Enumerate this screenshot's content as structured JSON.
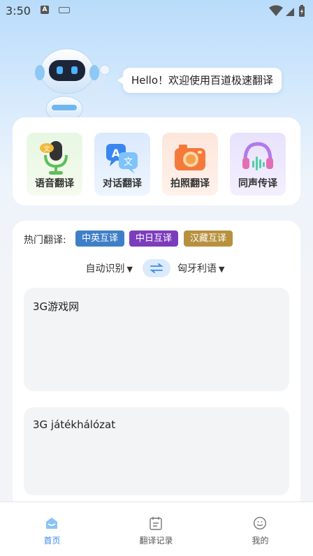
{
  "status_bar": {
    "time": "3:50",
    "notif_letter": "A"
  },
  "header": {
    "greeting": "Hello！欢迎使用百道极速翻译"
  },
  "features": [
    {
      "label": "语音翻译",
      "icon": "voice-translate-icon"
    },
    {
      "label": "对话翻译",
      "icon": "dialog-translate-icon"
    },
    {
      "label": "拍照翻译",
      "icon": "camera-translate-icon"
    },
    {
      "label": "同声传译",
      "icon": "simultaneous-interpret-icon"
    }
  ],
  "translate": {
    "hot_label": "热门翻译:",
    "hot_chips": [
      {
        "label": "中英互译",
        "color": "#3f7fc8"
      },
      {
        "label": "中日互译",
        "color": "#7c3dbd"
      },
      {
        "label": "汉藏互译",
        "color": "#b8913f"
      }
    ],
    "source_lang": "自动识别",
    "target_lang": "匈牙利语",
    "source_text": "3G游戏网",
    "result_text": "3G játékhálózat"
  },
  "tabbar": {
    "items": [
      {
        "label": "首页",
        "icon": "home-icon",
        "active": true
      },
      {
        "label": "翻译记录",
        "icon": "history-icon",
        "active": false
      },
      {
        "label": "我的",
        "icon": "profile-icon",
        "active": false
      }
    ],
    "active_color": "#3a8be6"
  }
}
